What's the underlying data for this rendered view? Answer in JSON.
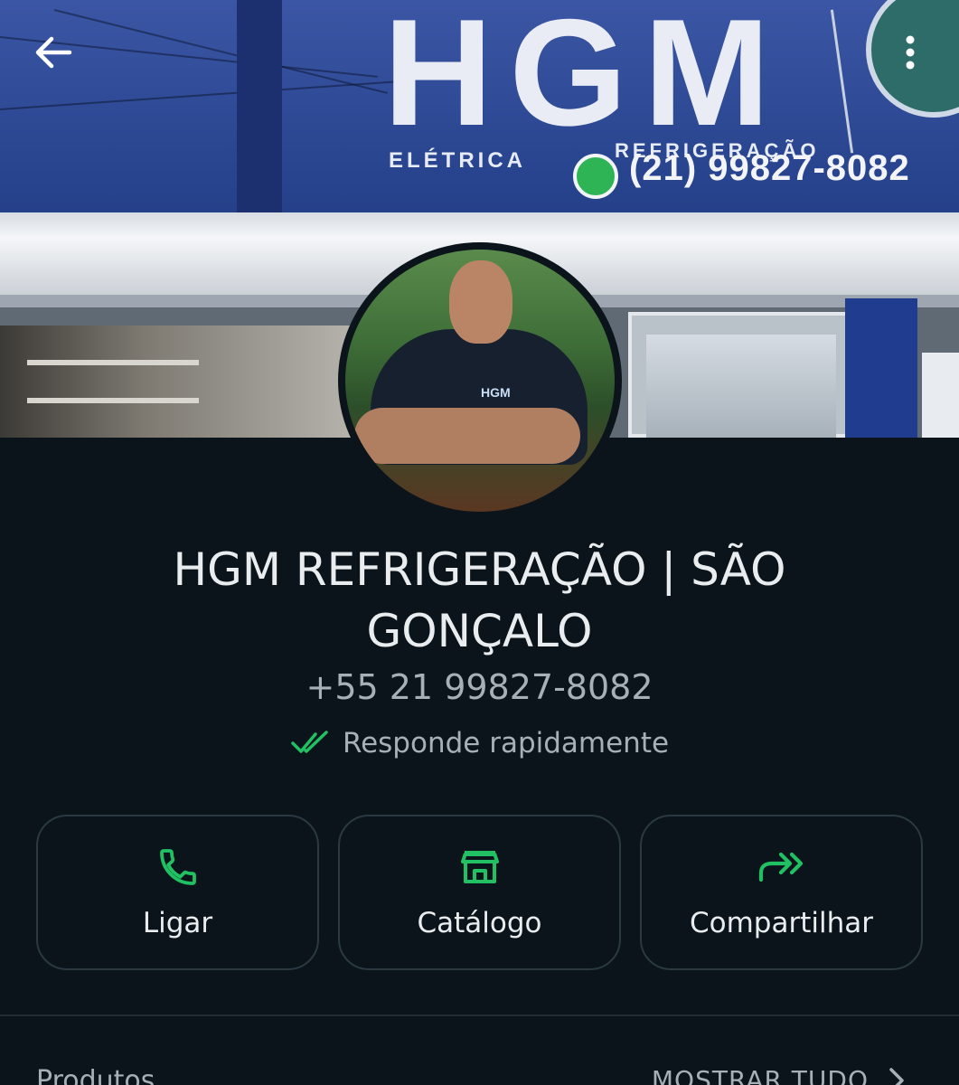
{
  "cover": {
    "sign_title": "HGM",
    "sign_left": "ELÉTRICA",
    "sign_right": "REFRIGERAÇÃO",
    "sign_phone": "(21) 99827-8082"
  },
  "profile": {
    "name": "HGM  REFRIGERAÇÃO | SÃO GONÇALO",
    "phone": "+55 21 99827-8082",
    "status": "Responde rapidamente",
    "avatar_shirt_logo": "HGM"
  },
  "actions": [
    {
      "label": "Ligar",
      "icon": "phone-icon"
    },
    {
      "label": "Catálogo",
      "icon": "storefront-icon"
    },
    {
      "label": "Compartilhar",
      "icon": "share-forward-icon"
    }
  ],
  "products": {
    "title": "Produtos",
    "show_all": "MOSTRAR TUDO"
  },
  "colors": {
    "background": "#0b141a",
    "accent": "#21c063",
    "text_primary": "#e9edef",
    "text_secondary": "#a5b0b7"
  }
}
